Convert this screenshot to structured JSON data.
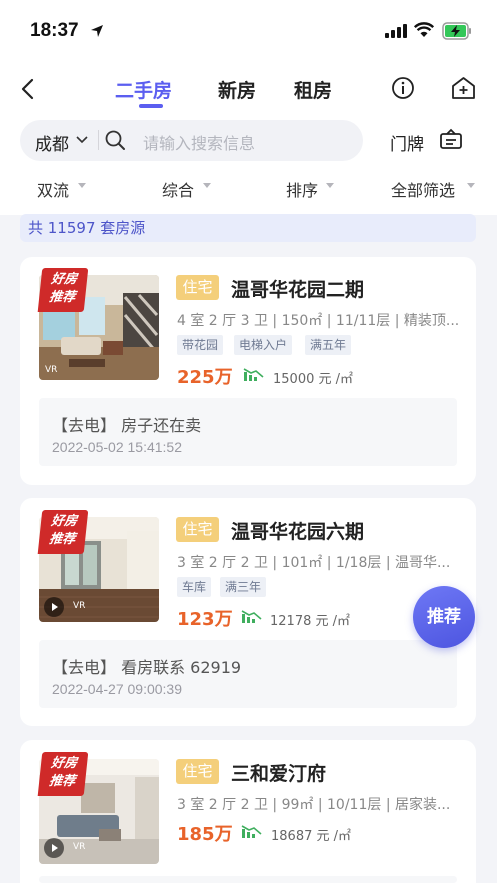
{
  "status": {
    "time": "18:37"
  },
  "nav": {
    "tabs": [
      {
        "label": "二手房",
        "active": true
      },
      {
        "label": "新房",
        "active": false
      },
      {
        "label": "租房",
        "active": false
      }
    ]
  },
  "search": {
    "city": "成都",
    "placeholder": "请输入搜索信息",
    "door_label": "门牌"
  },
  "filters": [
    "双流",
    "综合",
    "排序",
    "全部筛选"
  ],
  "total": "共 11597 套房源",
  "listings": [
    {
      "badge": [
        "好房",
        "推荐"
      ],
      "type": "住宅",
      "title": "温哥华花园二期",
      "desc": "4 室 2 厅 3 卫 | 150㎡ | 11/11层 | 精装顶...",
      "tags": [
        "带花园",
        "电梯入户",
        "满五年"
      ],
      "price": "225万",
      "unit_price": "15000 元 /㎡",
      "note": "【去电】 房子还在卖",
      "date": "2022-05-02 15:41:52",
      "vr": "VR"
    },
    {
      "badge": [
        "好房",
        "推荐"
      ],
      "type": "住宅",
      "title": "温哥华花园六期",
      "desc": "3 室 2 厅 2 卫 | 101㎡ | 1/18层 | 温哥华...",
      "tags": [
        "车库",
        "满三年"
      ],
      "price": "123万",
      "unit_price": "12178 元 /㎡",
      "note": "【去电】  看房联系 62919",
      "date": "2022-04-27 09:00:39",
      "vr": "VR"
    },
    {
      "badge": [
        "好房",
        "推荐"
      ],
      "type": "住宅",
      "title": "三和爱汀府",
      "desc": "3 室 2 厅 2 卫 | 99㎡ | 10/11层 | 居家装...",
      "tags": [],
      "price": "185万",
      "unit_price": "18687 元 /㎡",
      "vr": "VR"
    }
  ],
  "fab": {
    "label": "推荐"
  }
}
